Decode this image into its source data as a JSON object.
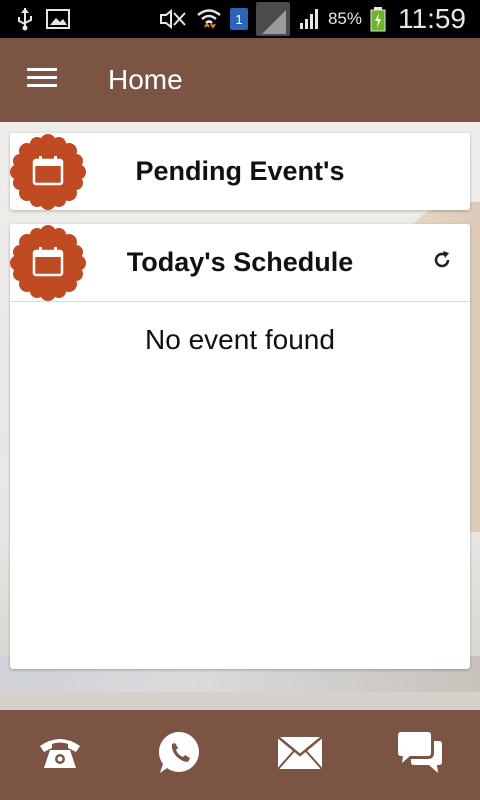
{
  "status_bar": {
    "battery": "85%",
    "time": "11:59",
    "sim_slot": "1",
    "icons": [
      "usb-icon",
      "gallery-icon",
      "mute-icon",
      "wifi-icon",
      "signal-icon",
      "battery-icon"
    ]
  },
  "app_bar": {
    "title": "Home",
    "menu_icon": "hamburger-menu-icon"
  },
  "cards": {
    "pending": {
      "title": "Pending Event's",
      "icon": "calendar-icon"
    },
    "today": {
      "title": "Today's Schedule",
      "icon": "calendar-icon",
      "empty_message": "No event found",
      "refresh_icon": "refresh-icon"
    }
  },
  "bottom_bar": {
    "items": [
      "phone-icon",
      "whatsapp-icon",
      "mail-icon",
      "chat-icon"
    ]
  },
  "colors": {
    "primary": "#7b5444",
    "badge": "#c04a22",
    "background": "#e9e6e2"
  }
}
